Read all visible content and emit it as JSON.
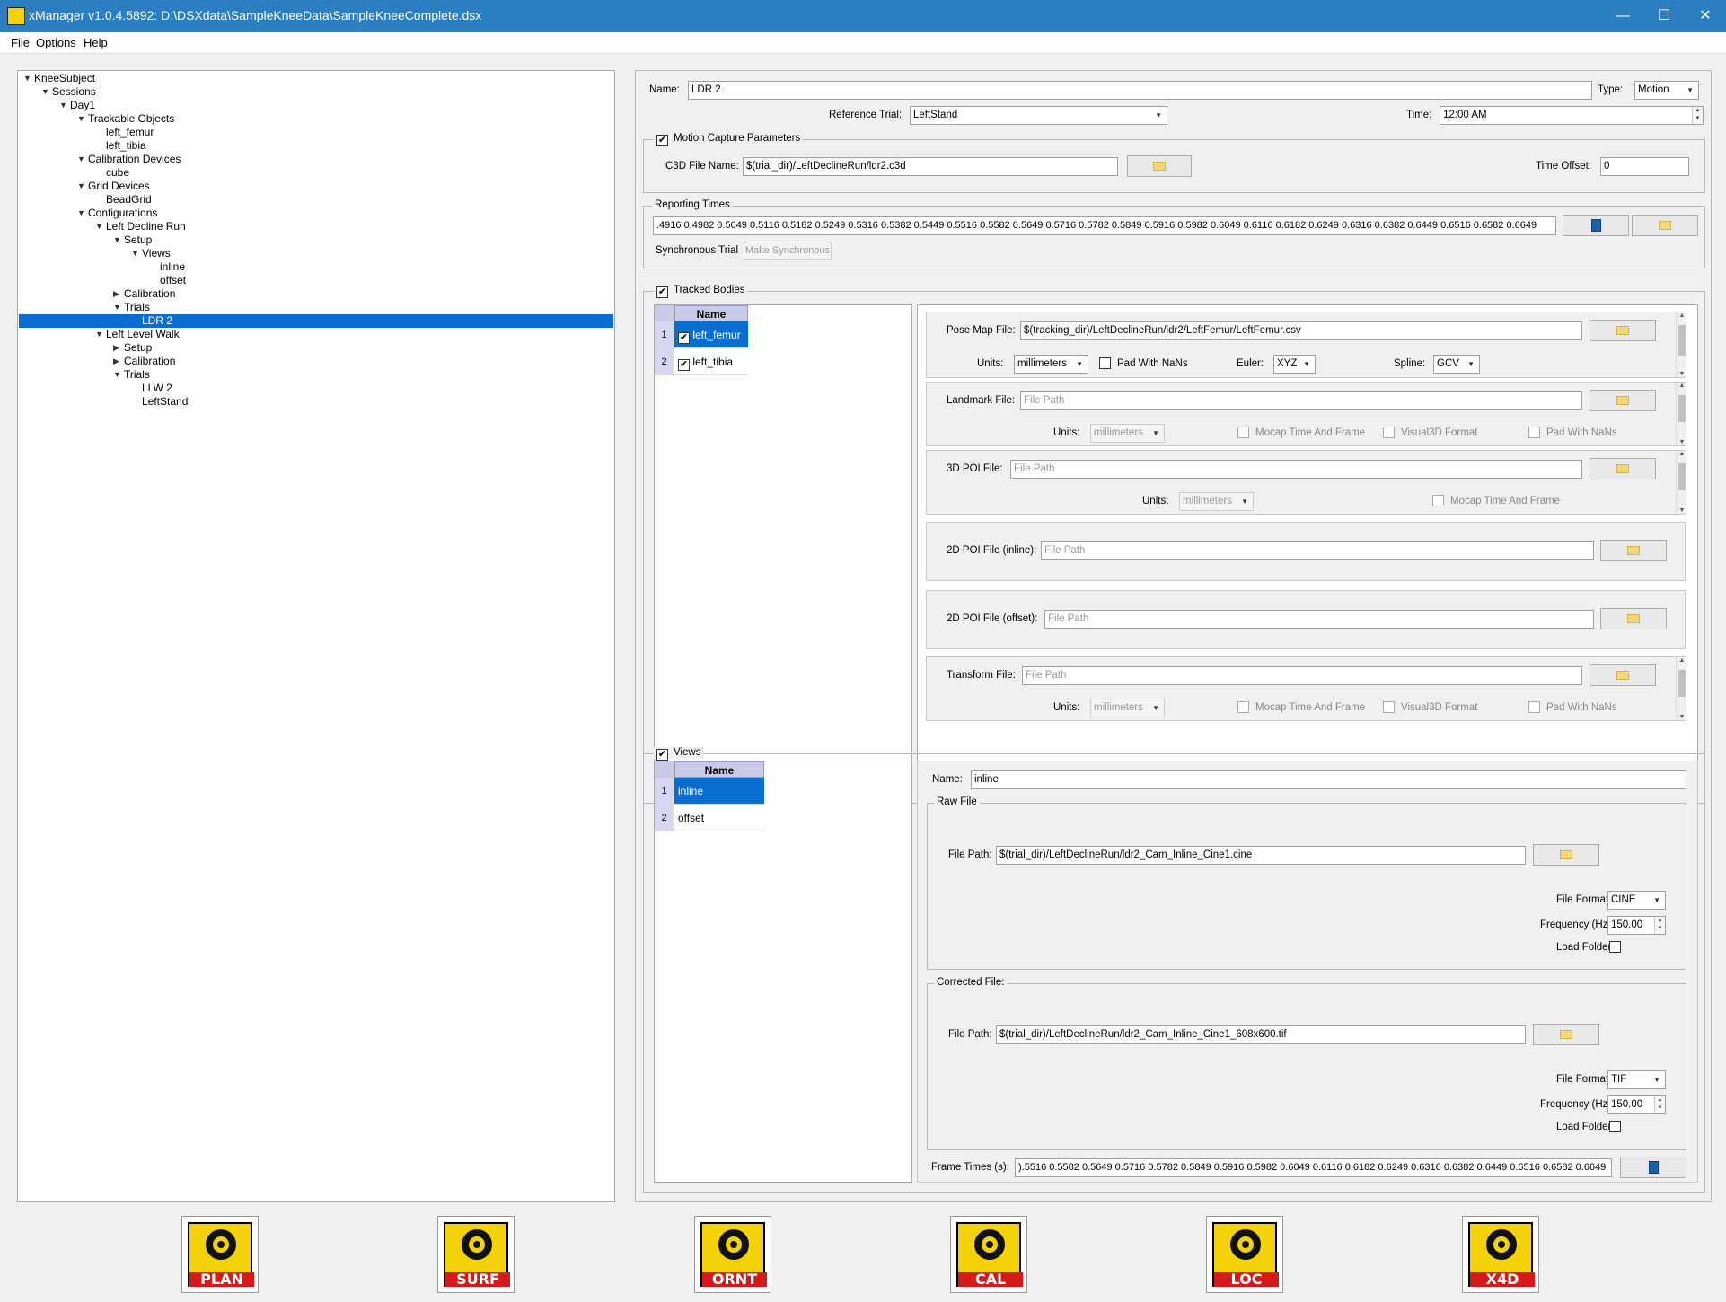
{
  "window": {
    "title": "xManager v1.0.4.5892: D:\\DSXdata\\SampleKneeData\\SampleKneeComplete.dsx",
    "minimize": "—",
    "maximize": "☐",
    "close": "✕"
  },
  "menu": [
    "File",
    "Options",
    "Help"
  ],
  "tree": [
    {
      "label": "KneeSubject",
      "level": 0,
      "expanded": true
    },
    {
      "label": "Sessions",
      "level": 1,
      "expanded": true
    },
    {
      "label": "Day1",
      "level": 2,
      "expanded": true
    },
    {
      "label": "Trackable Objects",
      "level": 3,
      "expanded": true
    },
    {
      "label": "left_femur",
      "level": 4
    },
    {
      "label": "left_tibia",
      "level": 4
    },
    {
      "label": "Calibration Devices",
      "level": 3,
      "expanded": true
    },
    {
      "label": "cube",
      "level": 4
    },
    {
      "label": "Grid Devices",
      "level": 3,
      "expanded": true
    },
    {
      "label": "BeadGrid",
      "level": 4
    },
    {
      "label": "Configurations",
      "level": 3,
      "expanded": true
    },
    {
      "label": "Left Decline Run",
      "level": 4,
      "expanded": true
    },
    {
      "label": "Setup",
      "level": 5,
      "expanded": true
    },
    {
      "label": "Views",
      "level": 6,
      "expanded": true
    },
    {
      "label": "inline",
      "level": 7
    },
    {
      "label": "offset",
      "level": 7
    },
    {
      "label": "Calibration",
      "level": 5,
      "expanded": false
    },
    {
      "label": "Trials",
      "level": 5,
      "expanded": true
    },
    {
      "label": "LDR 2",
      "level": 6,
      "selected": true
    },
    {
      "label": "Left Level Walk",
      "level": 4,
      "expanded": true
    },
    {
      "label": "Setup",
      "level": 5,
      "expanded": false
    },
    {
      "label": "Calibration",
      "level": 5,
      "expanded": false
    },
    {
      "label": "Trials",
      "level": 5,
      "expanded": true
    },
    {
      "label": "LLW 2",
      "level": 6
    },
    {
      "label": "LeftStand",
      "level": 6
    }
  ],
  "trial": {
    "name_label": "Name:",
    "name": "LDR 2",
    "type_label": "Type:",
    "type": "Motion",
    "ref_label": "Reference Trial:",
    "ref": "LeftStand",
    "time_label": "Time:",
    "time": "12:00 AM"
  },
  "mocap": {
    "title": "Motion Capture Parameters",
    "checked": true,
    "c3d_label": "C3D File Name:",
    "c3d": "$(trial_dir)/LeftDeclineRun/ldr2.c3d",
    "offset_label": "Time Offset:",
    "offset": "0"
  },
  "reporting": {
    "title": "Reporting Times",
    "times": ".4916 0.4982 0.5049 0.5116 0.5182 0.5249 0.5316 0.5382 0.5449 0.5516 0.5582 0.5649 0.5716 0.5782 0.5849 0.5916 0.5982 0.6049 0.6116 0.6182 0.6249 0.6316 0.6382 0.6449 0.6516 0.6582 0.6649",
    "sync_label": "Synchronous Trial",
    "sync_button": "Make Synchronous"
  },
  "tracked": {
    "title": "Tracked Bodies",
    "checked": true,
    "header": "Name",
    "rows": [
      {
        "num": "1",
        "name": "left_femur",
        "checked": true
      },
      {
        "num": "2",
        "name": "left_tibia",
        "checked": true
      }
    ],
    "pose_label": "Pose Map File:",
    "pose": "$(tracking_dir)/LeftDeclineRun/ldr2/LeftFemur/LeftFemur.csv",
    "units_label": "Units:",
    "units": "millimeters",
    "padnan_label": "Pad With NaNs",
    "euler_label": "Euler:",
    "euler": "XYZ",
    "spline_label": "Spline:",
    "spline": "GCV",
    "landmark_label": "Landmark File:",
    "placeholder": "File Path",
    "mocap_time_label": "Mocap Time And Frame",
    "visual3d_label": "Visual3D Format",
    "poi3d_label": "3D POI File:",
    "poi2d_inline_label": "2D POI File (inline):",
    "poi2d_offset_label": "2D POI File (offset):",
    "transform_label": "Transform File:"
  },
  "views": {
    "title": "Views",
    "checked": true,
    "header": "Name",
    "rows": [
      {
        "num": "1",
        "name": "inline",
        "selected": true
      },
      {
        "num": "2",
        "name": "offset"
      }
    ],
    "name_label": "Name:",
    "name": "inline",
    "raw_title": "Raw File",
    "filepath_label": "File Path:",
    "raw_path": "$(trial_dir)/LeftDeclineRun/ldr2_Cam_Inline_Cine1.cine",
    "format_label": "File Format:",
    "raw_format": "CINE",
    "freq_label": "Frequency (Hz):",
    "raw_freq": "150.00",
    "loadfolder_label": "Load Folder",
    "corr_title": "Corrected File:",
    "corr_path": "$(trial_dir)/LeftDeclineRun/ldr2_Cam_Inline_Cine1_608x600.tif",
    "corr_format": "TIF",
    "corr_freq": "150.00",
    "frametimes_label": "Frame Times (s):",
    "frametimes": ").5516 0.5582 0.5649 0.5716 0.5782 0.5849 0.5916 0.5982 0.6049 0.6116 0.6182 0.6249 0.6316 0.6382 0.6449 0.6516 0.6582 0.6649"
  },
  "apps": [
    "PLAN",
    "SURF",
    "ORNT",
    "CAL",
    "LOC",
    "X4D"
  ],
  "colors": {
    "titlebar": "#2b7ec0",
    "selection": "#0a6ed1",
    "logo_yellow": "#f4d20a",
    "logo_red": "#d61a1a"
  }
}
